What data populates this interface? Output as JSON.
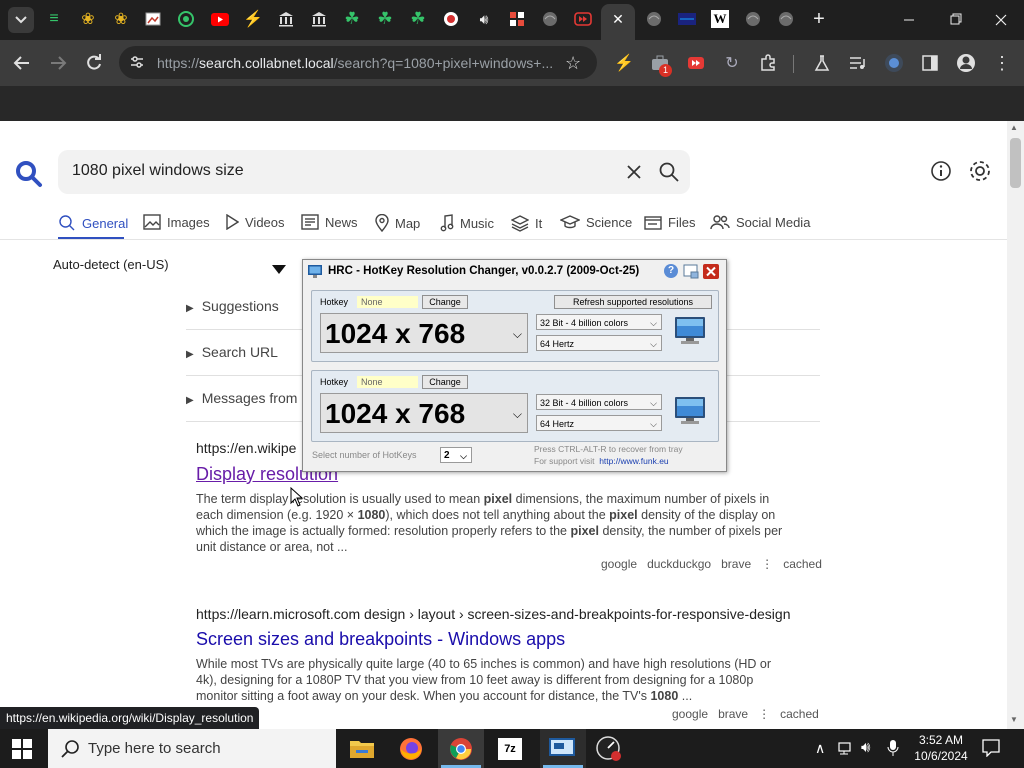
{
  "browser": {
    "active_tab_close": "✕",
    "new_tab": "+",
    "address_prefix": "https://",
    "address_host": "search.collabnet.local",
    "address_path": "/search?q=1080+pixel+windows+...",
    "extension_badge": "1"
  },
  "search": {
    "query": "1080 pixel windows size",
    "categories": [
      {
        "label": "General",
        "icon": "search-icon"
      },
      {
        "label": "Images",
        "icon": "image-icon"
      },
      {
        "label": "Videos",
        "icon": "play-icon"
      },
      {
        "label": "News",
        "icon": "news-icon"
      },
      {
        "label": "Map",
        "icon": "map-pin-icon"
      },
      {
        "label": "Music",
        "icon": "music-note-icon"
      },
      {
        "label": "It",
        "icon": "layers-icon"
      },
      {
        "label": "Science",
        "icon": "graduation-cap-icon"
      },
      {
        "label": "Files",
        "icon": "files-icon"
      },
      {
        "label": "Social Media",
        "icon": "people-icon"
      }
    ],
    "language": "Auto-detect (en-US)",
    "panels": [
      "Suggestions",
      "Search URL",
      "Messages from"
    ]
  },
  "results": [
    {
      "url": "https://en.wikipe",
      "title": "Display resolution",
      "snippet_lines": [
        [
          "The term display resolution is usually used to mean ",
          "pixel",
          " dimensions, the maximum number of pixels in"
        ],
        [
          "each dimension (e.g. 1920 × ",
          "1080",
          "), which does not tell anything about the ",
          "pixel",
          " density of the display on"
        ],
        [
          "which the image is actually formed: resolution properly refers to the ",
          "pixel",
          " density, the number of pixels per"
        ],
        [
          "unit distance or area, not ..."
        ]
      ],
      "links": [
        "google",
        "duckduckgo",
        "brave",
        "cached"
      ]
    },
    {
      "url": "https://learn.microsoft.com  design › layout › screen-sizes-and-breakpoints-for-responsive-design",
      "title": "Screen sizes and breakpoints - Windows apps",
      "snippet_lines": [
        [
          "While most TVs are physically quite large (40 to 65 inches is common) and have high resolutions (HD or"
        ],
        [
          "4k), designing for a 1080P TV that you view from 10 feet away is different from designing for a 1080p"
        ],
        [
          "monitor sitting a foot away on your desk. When you account for distance, the TV's ",
          "1080",
          " ..."
        ]
      ],
      "links": [
        "google",
        "brave",
        "cached"
      ]
    }
  ],
  "status_url": "https://en.wikipedia.org/wiki/Display_resolution",
  "hrc": {
    "title": "HRC - HotKey Resolution Changer, v0.0.2.7 (2009-Oct-25)",
    "hotkey_label": "Hotkey",
    "hotkey_value": "None",
    "change_label": "Change",
    "refresh_label": "Refresh supported resolutions",
    "resolution": "1024 x 768",
    "color_depth": "32 Bit - 4 billion colors",
    "refresh_rate": "64 Hertz",
    "num_hotkeys_label": "Select number of HotKeys",
    "num_hotkeys": "2",
    "recover_text": "Press CTRL-ALT-R to recover from tray",
    "support_text": "For support visit",
    "support_url": "http://www.funk.eu"
  },
  "taskbar": {
    "search_placeholder": "Type here to search",
    "time": "3:52 AM",
    "date": "10/6/2024"
  },
  "colors": {
    "accent": "#1a0dab",
    "visited": "#681da8",
    "close_red": "#c42b1c",
    "category_active": "#3050c0"
  }
}
